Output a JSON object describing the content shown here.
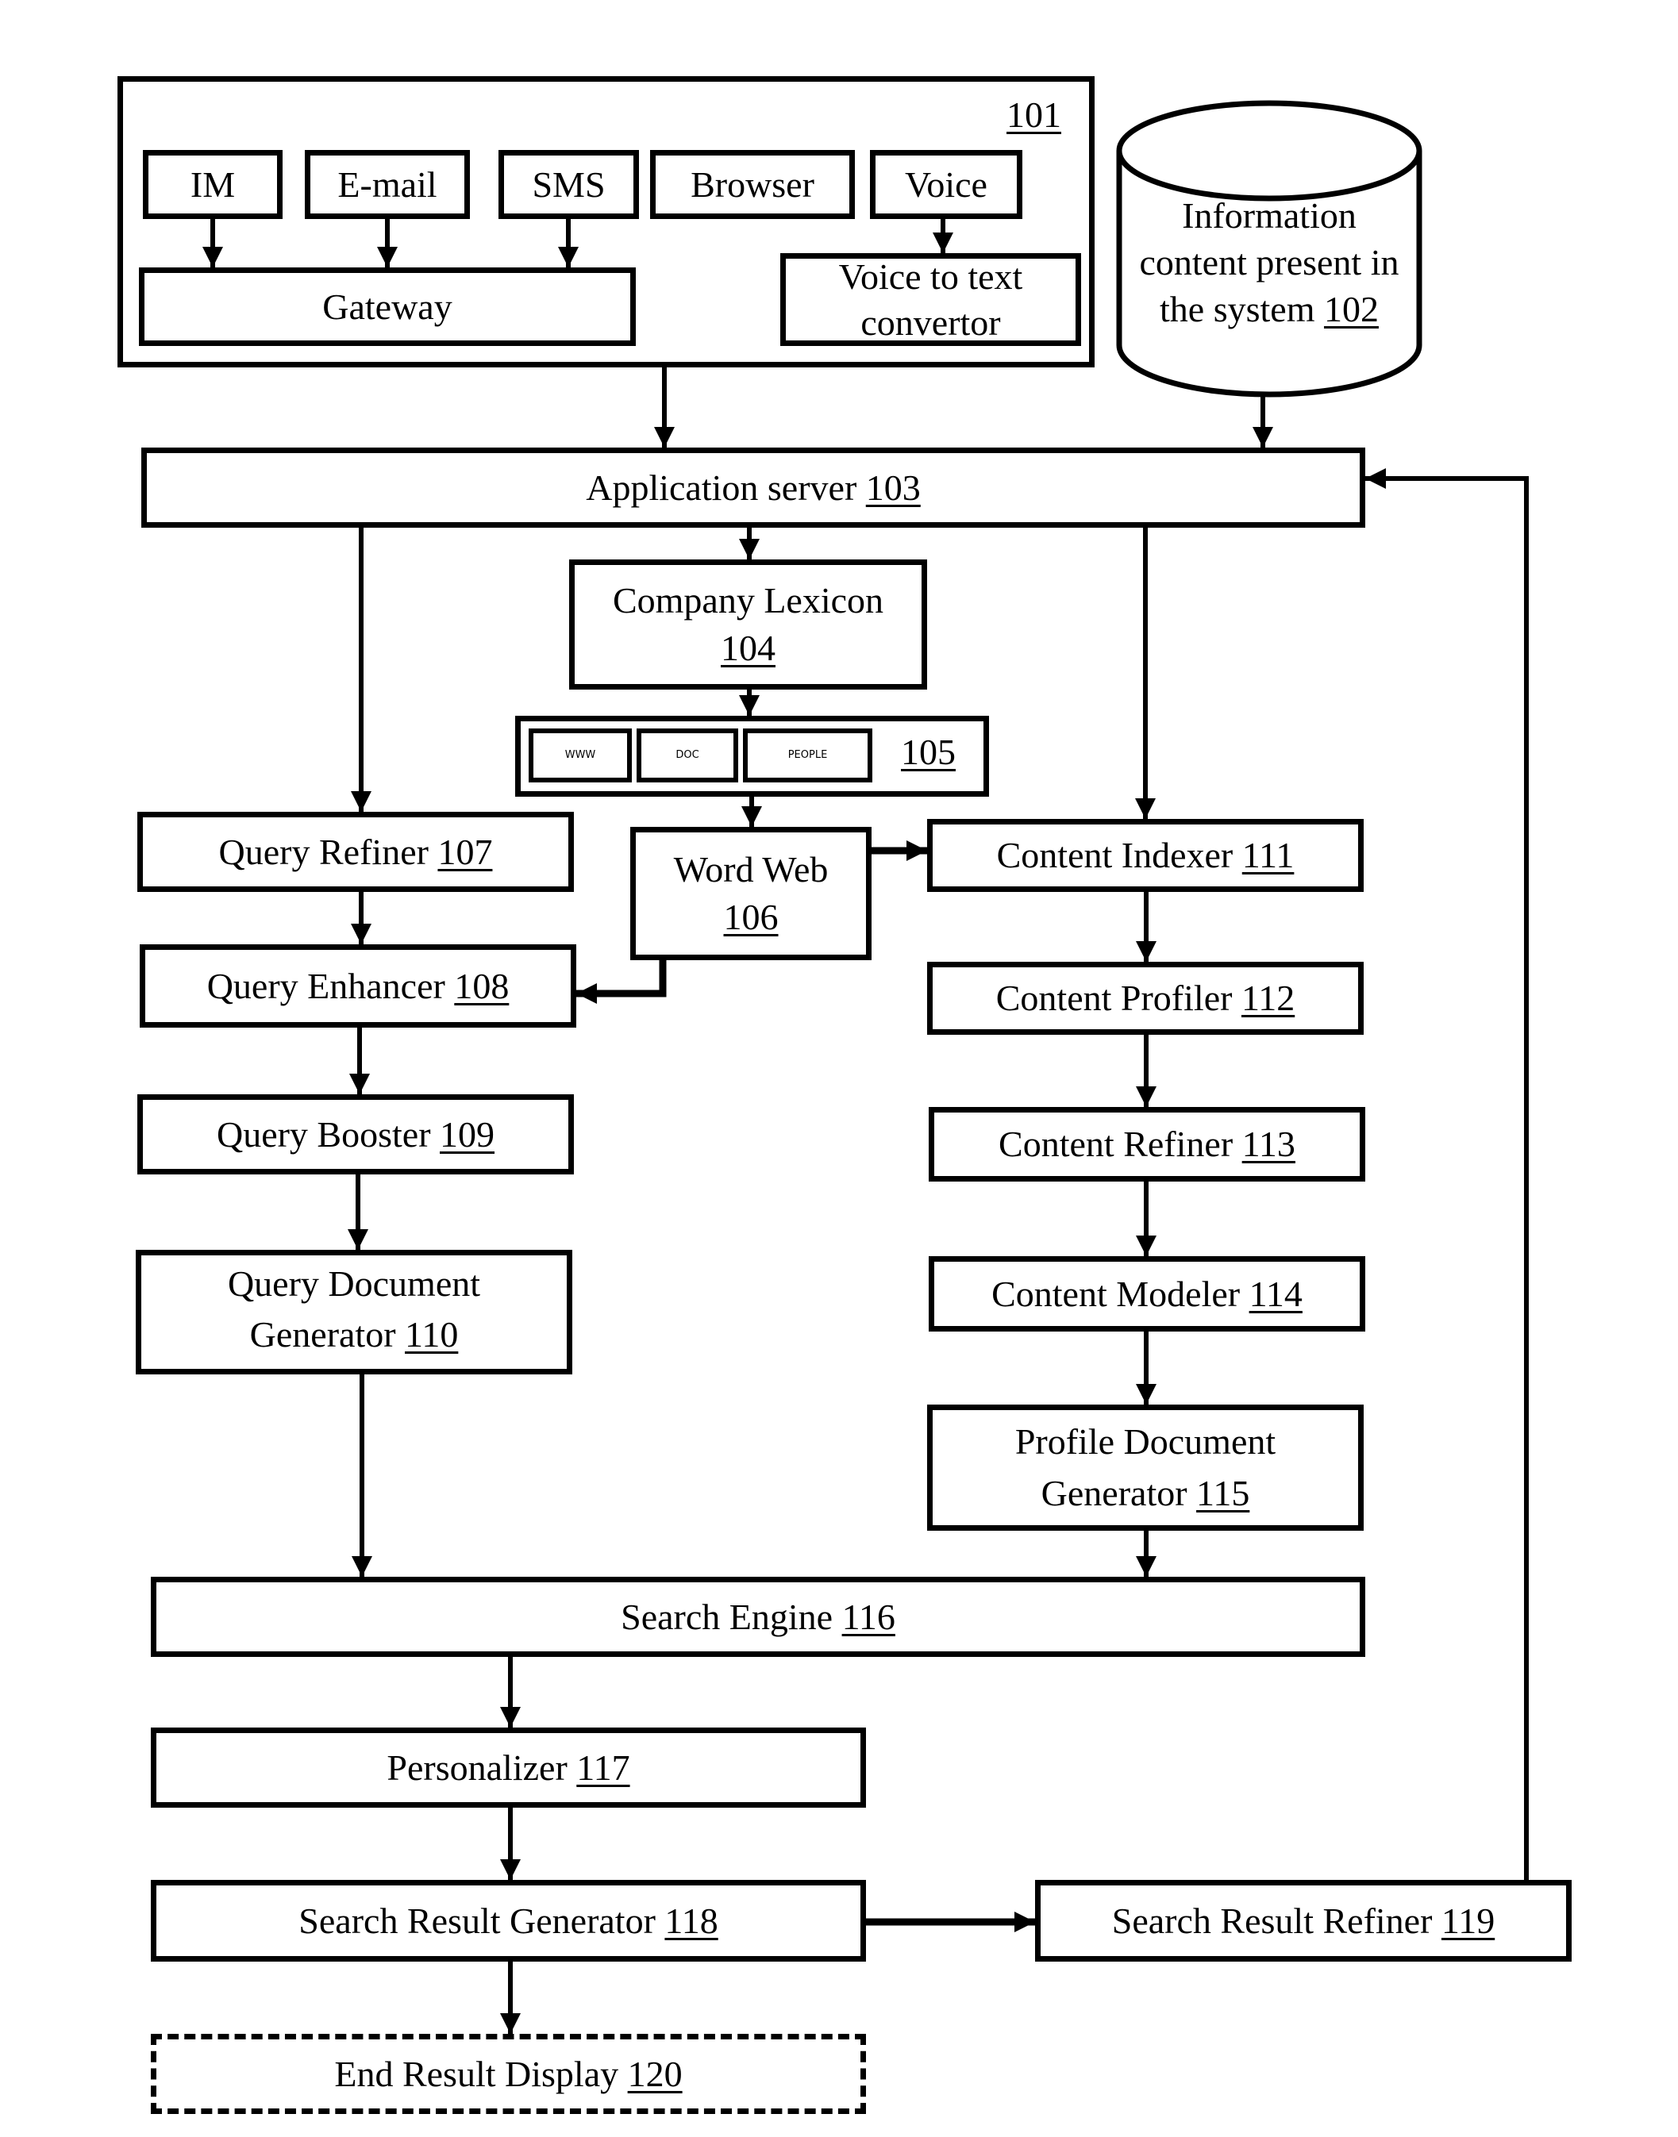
{
  "figure": {
    "type": "block-diagram",
    "line_color": "#000000",
    "background": "#ffffff"
  },
  "group_101": {
    "ref": "101",
    "channels": [
      {
        "id": "im",
        "label": "IM"
      },
      {
        "id": "email",
        "label": "E-mail"
      },
      {
        "id": "sms",
        "label": "SMS"
      },
      {
        "id": "browser",
        "label": "Browser"
      },
      {
        "id": "voice",
        "label": "Voice"
      }
    ],
    "gateway": {
      "label": "Gateway"
    },
    "voice_to_text": {
      "label": "Voice to text\nconvertor"
    }
  },
  "database_102": {
    "text": "Information\ncontent present in\nthe system ",
    "ref": "102"
  },
  "nodes": {
    "app_server": {
      "text": "Application server ",
      "ref": "103"
    },
    "company_lexicon": {
      "text": "Company Lexicon\n",
      "ref": "104"
    },
    "lexicon_sources": {
      "ref": "105",
      "items": [
        "WWW",
        "DOC",
        "PEOPLE"
      ]
    },
    "word_web": {
      "text": "Word Web\n",
      "ref": "106"
    },
    "query_refiner": {
      "text": "Query Refiner ",
      "ref": "107"
    },
    "query_enhancer": {
      "text": "Query Enhancer ",
      "ref": "108"
    },
    "query_booster": {
      "text": "Query Booster ",
      "ref": "109"
    },
    "query_doc_gen": {
      "text": "Query Document\nGenerator ",
      "ref": "110"
    },
    "content_indexer": {
      "text": "Content Indexer ",
      "ref": "111"
    },
    "content_profiler": {
      "text": "Content Profiler ",
      "ref": "112"
    },
    "content_refiner": {
      "text": "Content Refiner ",
      "ref": "113"
    },
    "content_modeler": {
      "text": "Content Modeler ",
      "ref": "114"
    },
    "profile_doc_gen": {
      "text": "Profile Document\nGenerator ",
      "ref": "115"
    },
    "search_engine": {
      "text": "Search Engine ",
      "ref": "116"
    },
    "personalizer": {
      "text": "Personalizer ",
      "ref": "117"
    },
    "search_result_gen": {
      "text": "Search Result Generator ",
      "ref": "118"
    },
    "search_result_refiner": {
      "text": "Search Result Refiner ",
      "ref": "119"
    },
    "end_result_display": {
      "text": "End Result Display ",
      "ref": "120",
      "style": "dashed"
    }
  },
  "edges": [
    [
      "IM",
      "Gateway"
    ],
    [
      "E-mail",
      "Gateway"
    ],
    [
      "SMS",
      "Gateway"
    ],
    [
      "Voice",
      "Voice to text convertor"
    ],
    [
      "101",
      "103"
    ],
    [
      "102",
      "103"
    ],
    [
      "103",
      "104"
    ],
    [
      "103",
      "107"
    ],
    [
      "103",
      "111"
    ],
    [
      "104",
      "105"
    ],
    [
      "105",
      "106"
    ],
    [
      "106",
      "111"
    ],
    [
      "106",
      "108"
    ],
    [
      "107",
      "108"
    ],
    [
      "108",
      "109"
    ],
    [
      "109",
      "110"
    ],
    [
      "110",
      "116"
    ],
    [
      "111",
      "112"
    ],
    [
      "112",
      "113"
    ],
    [
      "113",
      "114"
    ],
    [
      "114",
      "115"
    ],
    [
      "115",
      "116"
    ],
    [
      "116",
      "117"
    ],
    [
      "117",
      "118"
    ],
    [
      "118",
      "119"
    ],
    [
      "118",
      "120"
    ],
    [
      "119",
      "103"
    ]
  ]
}
